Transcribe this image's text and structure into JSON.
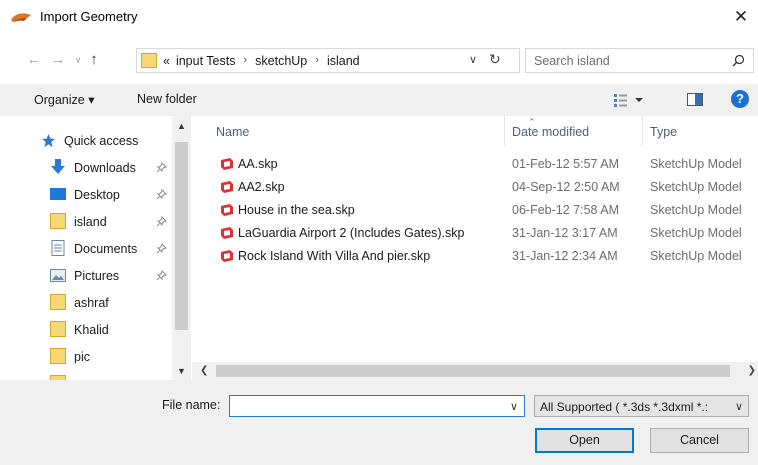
{
  "window": {
    "title": "Import Geometry",
    "close_glyph": "✕"
  },
  "nav": {
    "back_glyph": "←",
    "forward_glyph": "→",
    "recent_glyph": "∨",
    "up_glyph": "↑"
  },
  "address": {
    "overflow": "«",
    "crumbs": [
      "input Tests",
      "sketchUp",
      "island"
    ],
    "separator": "›",
    "dropdown_glyph": "∨",
    "refresh_glyph": "↻"
  },
  "search": {
    "placeholder": "Search island"
  },
  "toolbar": {
    "organize_label": "Organize ▾",
    "new_folder_label": "New folder",
    "help_label": "?"
  },
  "sidebar": {
    "items": [
      {
        "label": "Quick access",
        "icon": "star-icon",
        "pinned": false
      },
      {
        "label": "Downloads",
        "icon": "download-arrow-icon",
        "pinned": true
      },
      {
        "label": "Desktop",
        "icon": "desktop-icon",
        "pinned": true
      },
      {
        "label": "island",
        "icon": "folder-icon",
        "pinned": true
      },
      {
        "label": "Documents",
        "icon": "document-icon",
        "pinned": true
      },
      {
        "label": "Pictures",
        "icon": "pictures-icon",
        "pinned": true
      },
      {
        "label": "ashraf",
        "icon": "folder-icon",
        "pinned": false
      },
      {
        "label": "Khalid",
        "icon": "folder-icon",
        "pinned": false
      },
      {
        "label": "pic",
        "icon": "folder-icon",
        "pinned": false
      }
    ]
  },
  "files": {
    "columns": {
      "name": "Name",
      "date": "Date modified",
      "type": "Type"
    },
    "rows": [
      {
        "name": "AA.skp",
        "date": "01-Feb-12 5:57 AM",
        "type": "SketchUp Model"
      },
      {
        "name": "AA2.skp",
        "date": "04-Sep-12 2:50 AM",
        "type": "SketchUp Model"
      },
      {
        "name": "House in the sea.skp",
        "date": "06-Feb-12 7:58 AM",
        "type": "SketchUp Model"
      },
      {
        "name": "LaGuardia Airport 2 (Includes Gates).skp",
        "date": "31-Jan-12 3:17 AM",
        "type": "SketchUp Model"
      },
      {
        "name": "Rock Island With Villa And pier.skp",
        "date": "31-Jan-12 2:34 AM",
        "type": "SketchUp Model"
      }
    ]
  },
  "footer": {
    "file_name_label": "File name:",
    "file_name_value": "",
    "filter_value": "All Supported ( *.3ds *.3dxml *.:",
    "open_label": "Open",
    "cancel_label": "Cancel"
  },
  "colors": {
    "accent": "#0078d7",
    "folder": "#f8d775",
    "skp_red": "#e03030",
    "help_blue": "#1a6fd1"
  }
}
